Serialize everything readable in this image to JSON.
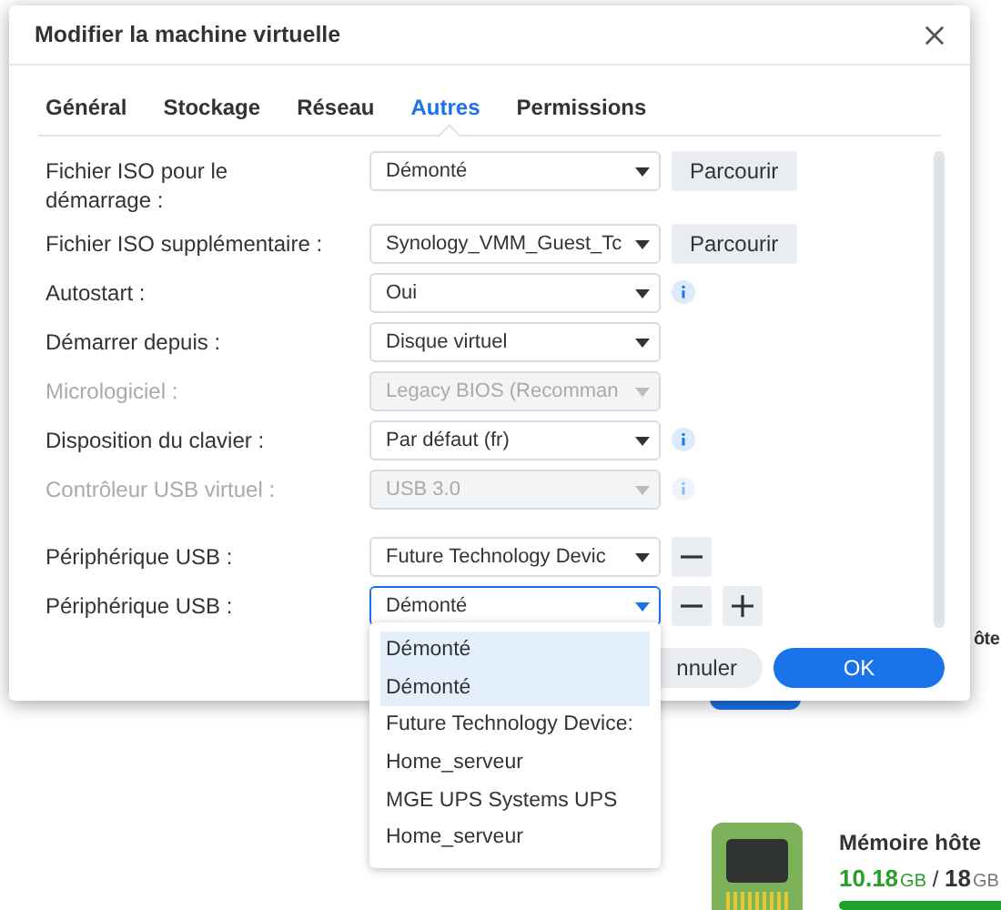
{
  "background": {
    "heading_fragment": "ôte",
    "memory": {
      "title": "Mémoire hôte",
      "used": "10.18",
      "used_unit": "GB",
      "separator": "/",
      "total": "18",
      "total_unit": "GB"
    }
  },
  "dialog": {
    "title": "Modifier la machine virtuelle",
    "tabs": [
      {
        "label": "Général",
        "selected": false
      },
      {
        "label": "Stockage",
        "selected": false
      },
      {
        "label": "Réseau",
        "selected": false
      },
      {
        "label": "Autres",
        "selected": true
      },
      {
        "label": "Permissions",
        "selected": false
      }
    ],
    "fields": [
      {
        "label": "Fichier ISO pour le démarrage :",
        "value": "Démonté",
        "disabled": false,
        "focused": false,
        "actions": [
          {
            "kind": "browse",
            "label": "Parcourir"
          }
        ]
      },
      {
        "label": "Fichier ISO supplémentaire :",
        "value": "Synology_VMM_Guest_Tc",
        "disabled": false,
        "focused": false,
        "actions": [
          {
            "kind": "browse",
            "label": "Parcourir"
          }
        ]
      },
      {
        "label": "Autostart :",
        "value": "Oui",
        "disabled": false,
        "focused": false,
        "actions": [
          {
            "kind": "info"
          }
        ]
      },
      {
        "label": "Démarrer depuis :",
        "value": "Disque virtuel",
        "disabled": false,
        "focused": false
      },
      {
        "label": "Micrologiciel :",
        "value": "Legacy BIOS (Recomman",
        "disabled": true,
        "focused": false
      },
      {
        "label": "Disposition du clavier :",
        "value": "Par défaut (fr)",
        "disabled": false,
        "focused": false,
        "actions": [
          {
            "kind": "info"
          }
        ]
      },
      {
        "label": "Contrôleur USB virtuel :",
        "value": "USB 3.0",
        "disabled": true,
        "focused": false,
        "actions": [
          {
            "kind": "info"
          }
        ]
      },
      {
        "label": "Périphérique USB :",
        "value": "Future Technology Devic",
        "disabled": false,
        "focused": false,
        "actions": [
          {
            "kind": "remove"
          }
        ]
      },
      {
        "label": "Périphérique USB :",
        "value": "Démonté",
        "disabled": false,
        "focused": true,
        "actions": [
          {
            "kind": "remove"
          },
          {
            "kind": "add"
          }
        ]
      }
    ],
    "buttons": [
      {
        "kind": "secondary",
        "label": "nnuler"
      },
      {
        "kind": "primary",
        "label": "OK"
      }
    ]
  },
  "dropdown": {
    "items": [
      {
        "label": "Démonté",
        "selected": true
      },
      {
        "label": "Démonté",
        "selected": true
      },
      {
        "label": "Future Technology Device:",
        "selected": false
      },
      {
        "label": "Home_serveur",
        "selected": false
      },
      {
        "label": "MGE UPS Systems UPS",
        "selected": false
      },
      {
        "label": "Home_serveur",
        "selected": false
      }
    ]
  }
}
